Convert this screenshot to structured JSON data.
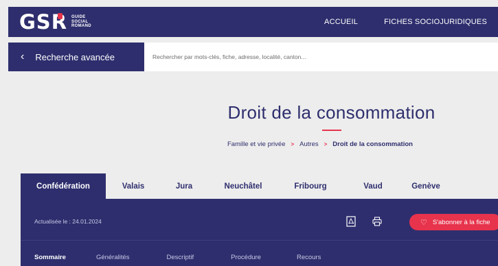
{
  "header": {
    "logo": {
      "mark": "GSR",
      "line1": "GUIDE",
      "line2": "SOCIAL",
      "line3": "ROMAND"
    },
    "nav": [
      {
        "label": "ACCUEIL"
      },
      {
        "label": "FICHES SOCIOJURIDIQUES"
      }
    ]
  },
  "search": {
    "advanced_label": "Recherche avancée",
    "placeholder": "Rechercher par mots-clés, fiche, adresse, localité, canton..."
  },
  "page": {
    "title": "Droit de la consommation",
    "breadcrumb": [
      "Famille et vie privée",
      "Autres",
      "Droit de la consommation"
    ],
    "breadcrumb_separator": ">"
  },
  "tabs": [
    {
      "label": "Confédération",
      "active": true
    },
    {
      "label": "Valais"
    },
    {
      "label": "Jura"
    },
    {
      "label": "Neuchâtel"
    },
    {
      "label": "Fribourg"
    },
    {
      "label": "Vaud"
    },
    {
      "label": "Genève"
    }
  ],
  "panel": {
    "updated_label": "Actualisée le : 24.01.2024",
    "subscribe_label": "S'abonner à la fiche",
    "icons": [
      "pdf-icon",
      "print-icon",
      "heart-icon"
    ]
  },
  "sections": [
    {
      "label": "Sommaire",
      "active": true
    },
    {
      "label": "Généralités"
    },
    {
      "label": "Descriptif"
    },
    {
      "label": "Procédure"
    },
    {
      "label": "Recours"
    }
  ],
  "colors": {
    "navy": "#2e2e6e",
    "accent": "#e7334c",
    "background": "#ededed"
  }
}
